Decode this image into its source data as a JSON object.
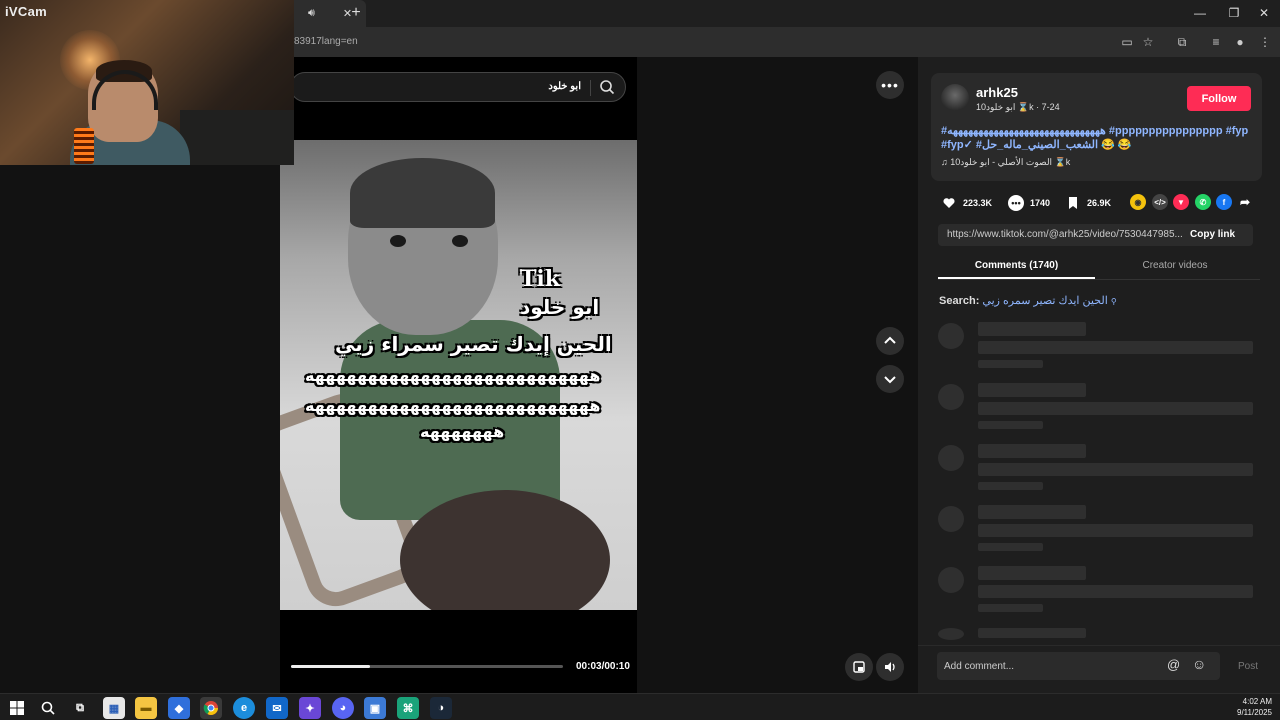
{
  "webcam": {
    "label": "iVCam"
  },
  "browser": {
    "tab_close": "✕",
    "new_tab": "+",
    "address": "83917lang=en",
    "window_controls": [
      "—",
      "❐",
      "✕"
    ]
  },
  "search": {
    "value": "ابو خلود"
  },
  "video": {
    "overlay": {
      "tik": "Tik",
      "name": "ابو خلود",
      "line1": "الحين إيدك تصير سمراء زيي",
      "line2": "هههههههههههههههههههههههههههه",
      "line3": "هههههههههههههههههههههههههههه",
      "line4": "هههههههه"
    },
    "time": "00:03/00:10",
    "progress": 0.29
  },
  "author": {
    "username": "arhk25",
    "subline": "ابو خلود10 ⌛k · 7-24",
    "follow_label": "Follow"
  },
  "caption": {
    "hashtags": "#ههههههههههههههههههههههههههههههه #pppppppppppppppp #fyp #fyp✓ #الشعب_الصيني_ماله_حل",
    "emoji": "😂 😂"
  },
  "music": {
    "label": "♫ الصوت الأصلي - ابو خلود10 ⌛k"
  },
  "stats": {
    "likes": "223.3K",
    "comments": "1740",
    "saves": "26.9K"
  },
  "link": {
    "url": "https://www.tiktok.com/@arhk25/video/7530447985...",
    "copy_label": "Copy link"
  },
  "tabs": {
    "comments": "Comments (1740)",
    "creator": "Creator videos"
  },
  "related_search": {
    "prefix": "Search:",
    "query": "الحين ايدك تصير سمره زيي"
  },
  "comment_input": {
    "placeholder": "Add comment...",
    "post_label": "Post"
  },
  "taskbar": {
    "time": "4:02 AM",
    "date": "9/11/2025"
  },
  "colors": {
    "follow": "#fe2c55",
    "hashtag": "#8fb6ff",
    "share_whatsapp": "#25d366",
    "share_facebook": "#1877f2",
    "share_red": "#fe2c55",
    "coin": "#f4c20d"
  }
}
